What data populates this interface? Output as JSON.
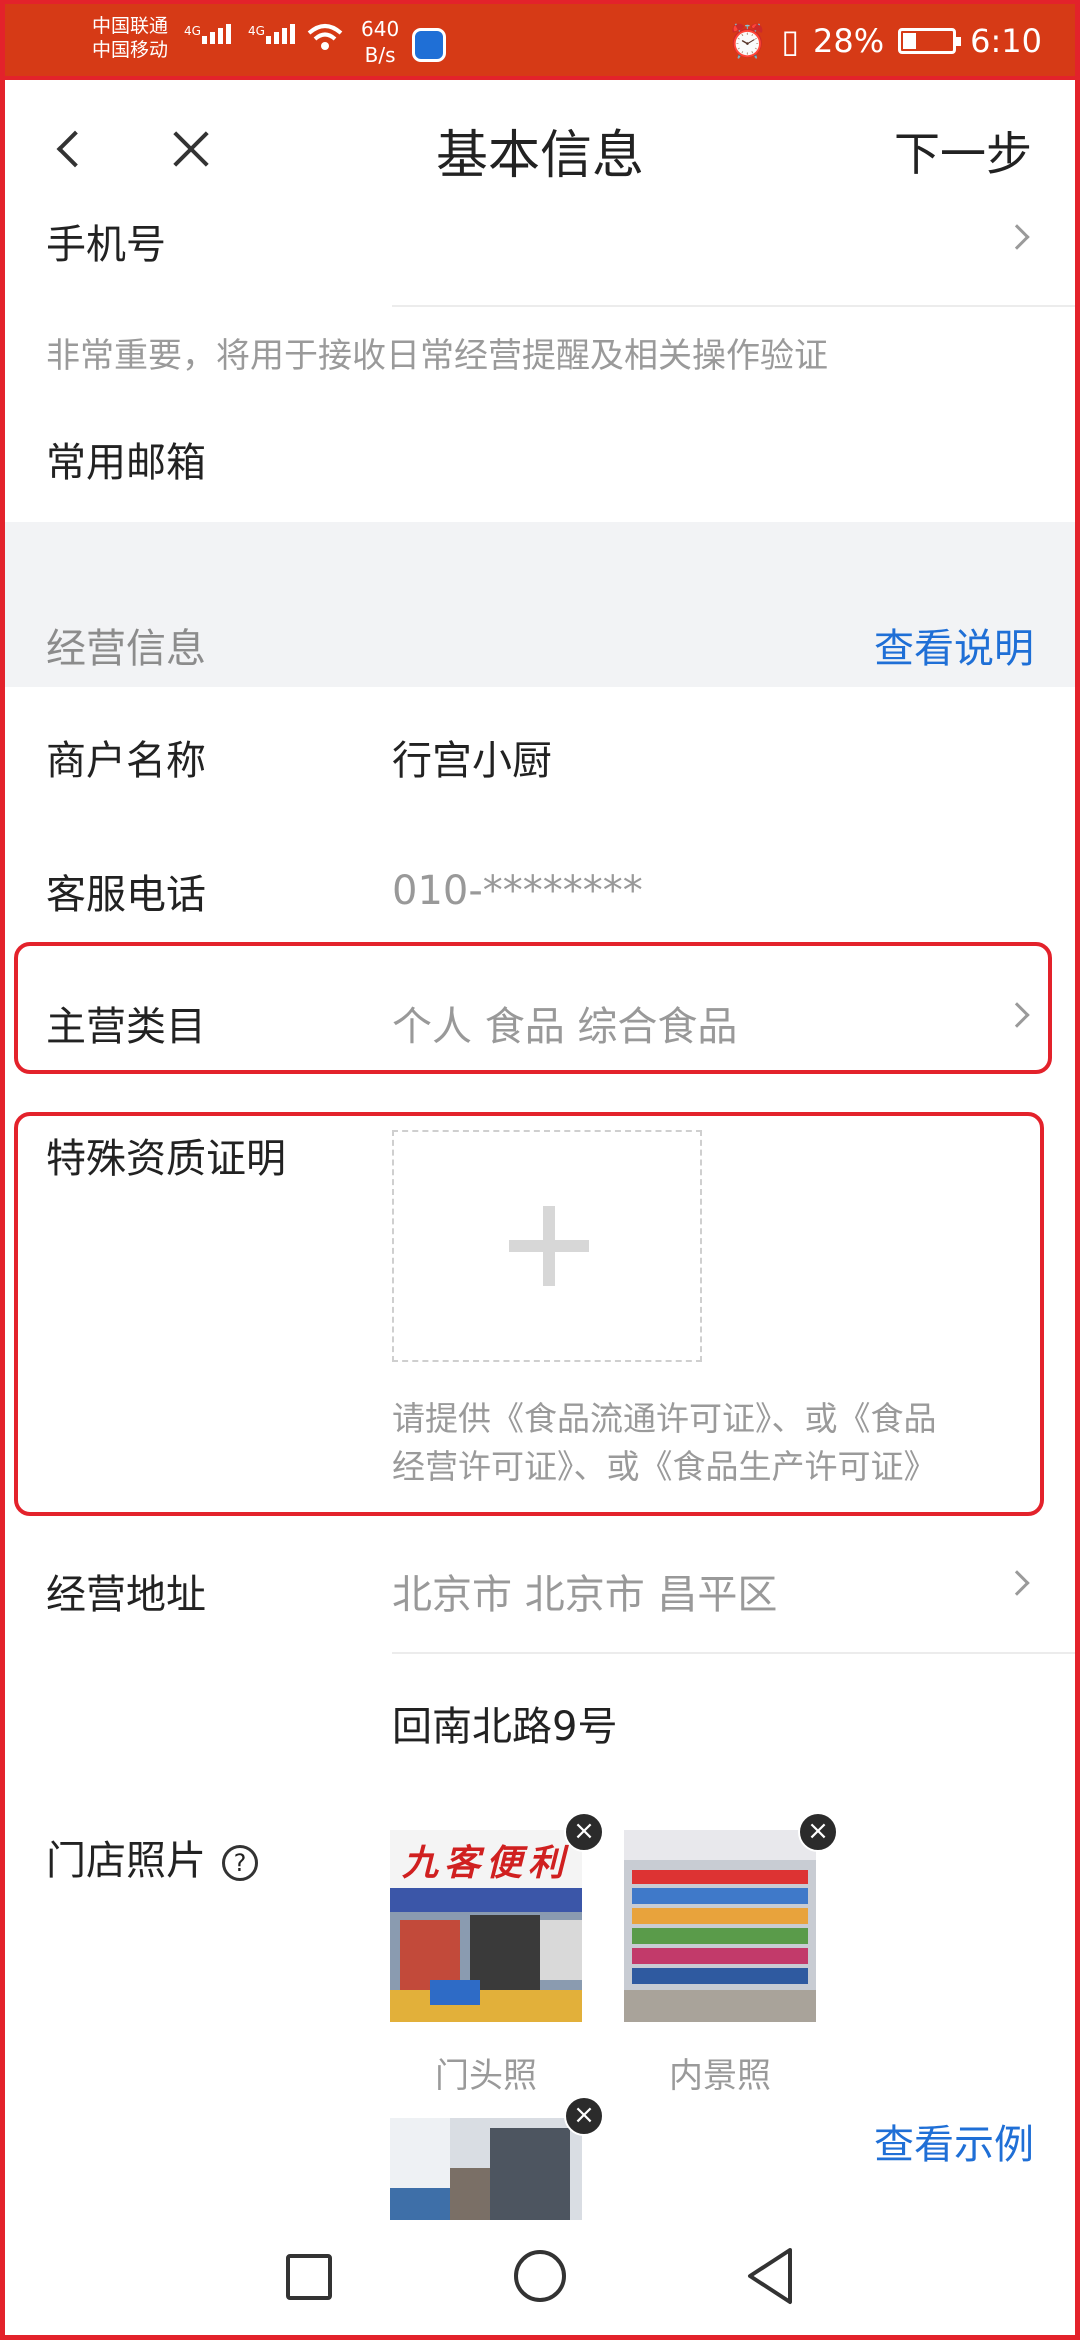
{
  "status_bar": {
    "carrier1": "中国联通",
    "carrier2": "中国移动",
    "net1": "4G",
    "net2": "4G",
    "speed_value": "640",
    "speed_unit": "B/s",
    "battery": "28%",
    "time": "6:10"
  },
  "header": {
    "title": "基本信息",
    "next_label": "下一步"
  },
  "contact": {
    "phone_label": "手机号",
    "phone_note": "非常重要，将用于接收日常经营提醒及相关操作验证",
    "email_label": "常用邮箱"
  },
  "business": {
    "section_title": "经营信息",
    "section_link": "查看说明",
    "merchant_name_label": "商户名称",
    "merchant_name_value": "行宫小厨",
    "service_phone_label": "客服电话",
    "service_phone_value": "010-********",
    "category_label": "主营类目",
    "category_value": "个人 食品 综合食品",
    "qualification_label": "特殊资质证明",
    "qualification_hint_line1": "请提供《食品流通许可证》、或《食品",
    "qualification_hint_line2": "经营许可证》、或《食品生产许可证》",
    "address_label": "经营地址",
    "address_region": "北京市 北京市 昌平区",
    "address_detail": "回南北路9号",
    "store_photos_label": "门店照片",
    "photo_caption_front": "门头照",
    "photo_caption_interior": "内景照",
    "view_example_link": "查看示例",
    "storefront_sign": "九客便利"
  },
  "colors": {
    "accent": "#1f6fd6",
    "status_bar": "#d63a16",
    "highlight": "#e3222b"
  }
}
